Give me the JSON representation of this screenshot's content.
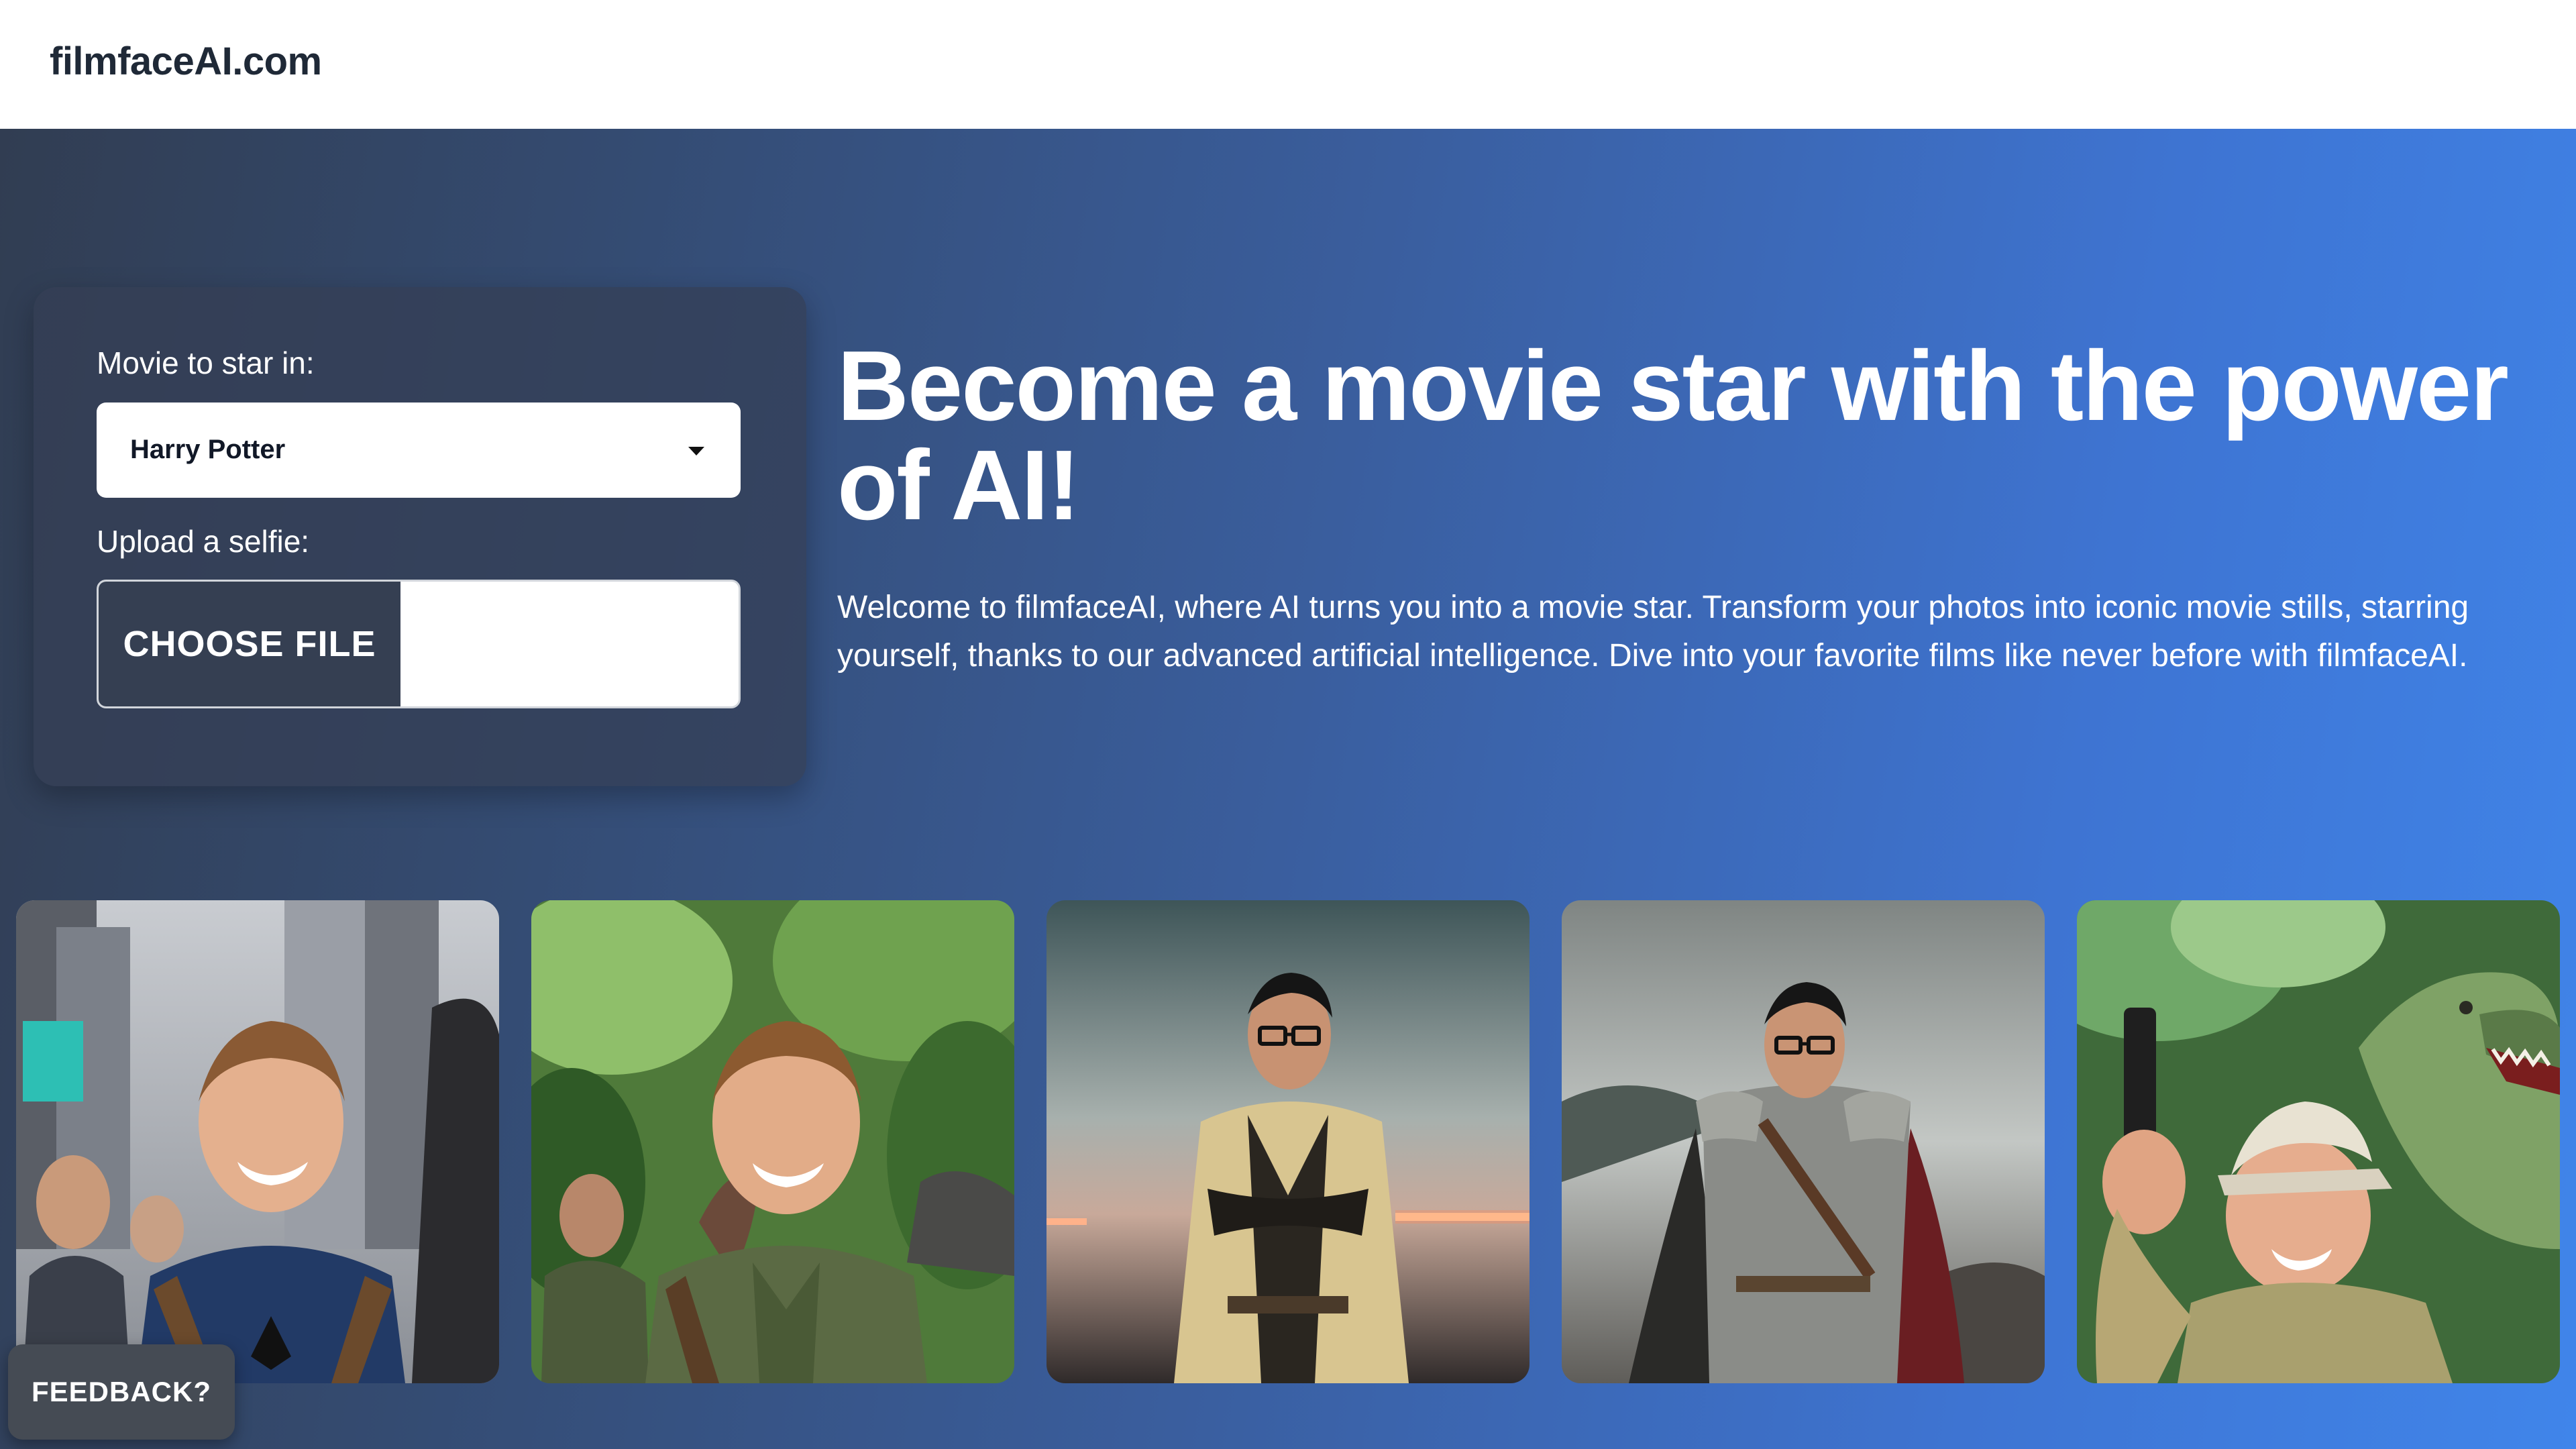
{
  "site": {
    "brand": "filmfaceAI.com"
  },
  "form": {
    "movie_label": "Movie to star in:",
    "movie_selected": "Harry Potter",
    "selfie_label": "Upload a selfie:",
    "file_button_label": "CHOOSE FILE",
    "file_name": ""
  },
  "hero": {
    "headline": "Become a movie star with the power of AI!",
    "intro": "Welcome to filmfaceAI, where AI turns you into a movie star. Transform your photos into iconic movie stills, starring yourself, thanks to our advanced artificial intelligence. Dive into your favorite films like never before with filmfaceAI."
  },
  "gallery": {
    "images": [
      {
        "name": "spider-suit-city-photo"
      },
      {
        "name": "jungle-explorer-photo"
      },
      {
        "name": "jedi-lightsaber-photo"
      },
      {
        "name": "armored-knight-photo"
      },
      {
        "name": "dinosaur-hunter-photo"
      }
    ]
  },
  "feedback": {
    "label": "FEEDBACK?"
  },
  "colors": {
    "gradient_start": "#313d52",
    "gradient_end": "#4085ea",
    "card_background": "#343f54",
    "file_button": "#353f52",
    "feedback_button": "#454b54"
  },
  "icons": {
    "select_arrow": "caret-down-icon"
  }
}
